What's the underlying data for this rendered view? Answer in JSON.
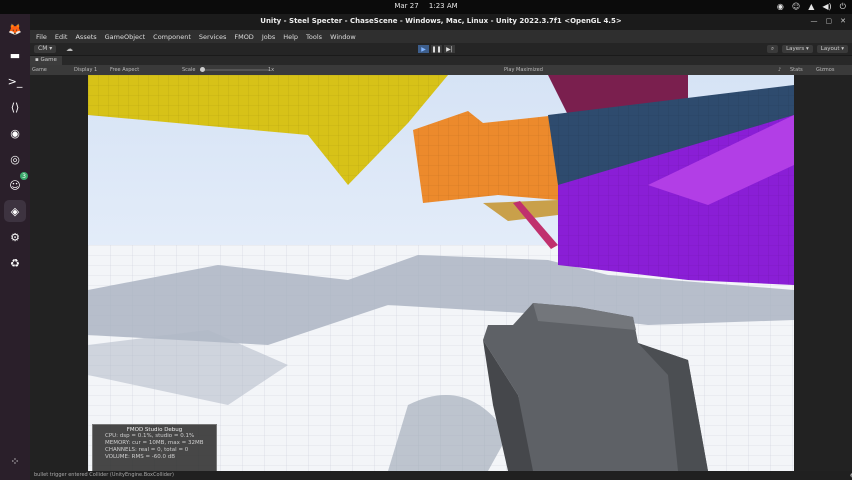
{
  "system": {
    "date": "Mar 27",
    "time": "1:23 AM"
  },
  "dock": {
    "items": [
      {
        "name": "firefox-icon",
        "glyph": "🦊"
      },
      {
        "name": "files-icon",
        "glyph": "▬"
      },
      {
        "name": "terminal-icon",
        "glyph": ">_"
      },
      {
        "name": "vscode-icon",
        "glyph": "⟨⟩"
      },
      {
        "name": "github-icon",
        "glyph": "◉"
      },
      {
        "name": "obs-icon",
        "glyph": "◎"
      },
      {
        "name": "discord-icon",
        "glyph": "☺",
        "badge": "3"
      },
      {
        "name": "unity-hub-icon",
        "glyph": "◈"
      },
      {
        "name": "settings-icon",
        "glyph": "⚙"
      },
      {
        "name": "trash-icon",
        "glyph": "♻"
      }
    ]
  },
  "window": {
    "title": "Unity - Steel Specter - ChaseScene - Windows, Mac, Linux - Unity 2022.3.7f1 <OpenGL 4.5>"
  },
  "menu": [
    "File",
    "Edit",
    "Assets",
    "GameObject",
    "Component",
    "Services",
    "FMOD",
    "Jobs",
    "Help",
    "Tools",
    "Window"
  ],
  "toolbar": {
    "account": "CM",
    "layers": "Layers",
    "layout": "Layout"
  },
  "tabs": {
    "game": "Game"
  },
  "gamebar": {
    "mode": "Game",
    "display": "Display 1",
    "aspect": "Free Aspect",
    "scale_label": "Scale",
    "scale_value": "1x",
    "play_mode": "Play Maximized",
    "stats": "Stats",
    "gizmos": "Gizmos"
  },
  "debug": {
    "title": "FMOD Studio Debug",
    "lines": [
      "CPU: dsp = 0.1%, studio = 0.1%",
      "MEMORY: cur = 10MB, max = 32MB",
      "CHANNELS: real = 0, total = 0",
      "VOLUME: RMS = -60.0 dB"
    ]
  },
  "status": {
    "message": "bullet trigger entered Collider (UnityEngine.BoxCollider)"
  },
  "colors": {
    "sky": "#e8f1ff",
    "floor": "#f2f4f7",
    "yellow": "#d8c21a",
    "orange": "#ec8a2c",
    "purple": "#8a1ed6",
    "navy": "#2e4b6e",
    "gun": "#5e6166"
  }
}
